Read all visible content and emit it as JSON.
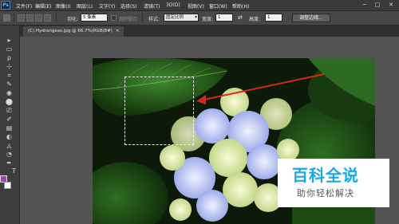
{
  "app": {
    "logo": "Ps"
  },
  "menu": [
    "文件(F)",
    "编辑(E)",
    "图像(I)",
    "图层(L)",
    "文字(Y)",
    "选择(S)",
    "滤镜(T)",
    "3D(D)",
    "视图(V)",
    "窗口(W)",
    "帮助(H)"
  ],
  "window_controls": {
    "minimize": "─",
    "maximize": "□",
    "close": "✕"
  },
  "options": {
    "feather_label": "羽化:",
    "feather_value": "5 像素",
    "antialias_label": "消除锯齿",
    "style_label": "样式:",
    "style_value": "固定比例",
    "width_label": "宽度:",
    "width_value": "1",
    "swap_icon": "⇄",
    "height_label": "高度:",
    "height_value": "1",
    "refine_button": "调整边缘..."
  },
  "document": {
    "tab_title": "(C) Hydrangeas.jpg @ 66.7%(RGB/8#)",
    "close": "×"
  },
  "tools": [
    "▸",
    "▭",
    "ρ",
    "⊹",
    "⌗",
    "✎",
    "◉",
    "⬤",
    "⎚",
    "✐",
    "▤",
    "◐",
    "◬",
    "◔",
    "✒",
    "T",
    "↖",
    "▭",
    "☚",
    "🔍"
  ],
  "colors": {
    "foreground": "#a63fbf",
    "background": "#ffffff",
    "arrow": "#d42a1e"
  },
  "watermark": {
    "title": "百科全说",
    "subtitle": "助你轻松解决"
  }
}
